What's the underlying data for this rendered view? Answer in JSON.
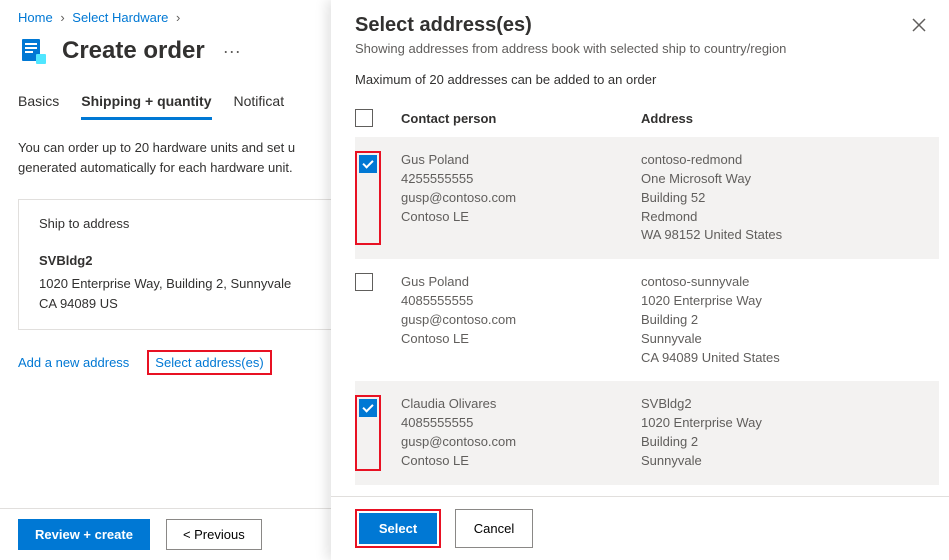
{
  "breadcrumb": {
    "home": "Home",
    "select_hw": "Select Hardware"
  },
  "page": {
    "title": "Create order",
    "tabs": {
      "basics": "Basics",
      "shipping": "Shipping + quantity",
      "notif": "Notificat"
    },
    "desc_line1": "You can order up to 20 hardware units and set u",
    "desc_line2": "generated automatically for each hardware unit."
  },
  "ship": {
    "label": "Ship to address",
    "name": "SVBldg2",
    "line1": "1020 Enterprise Way, Building 2, Sunnyvale",
    "line2": "CA 94089 US"
  },
  "actions": {
    "add_new": "Add a new address",
    "select_addr": "Select address(es)"
  },
  "footer": {
    "review": "Review + create",
    "prev": "< Previous"
  },
  "panel": {
    "title": "Select address(es)",
    "sub": "Showing addresses from address book with selected ship to country/region",
    "note": "Maximum of 20 addresses can be added to an order",
    "col_contact": "Contact person",
    "col_address": "Address",
    "select_btn": "Select",
    "cancel_btn": "Cancel",
    "rows": [
      {
        "checked": true,
        "contact": [
          "Gus Poland",
          "4255555555",
          "gusp@contoso.com",
          "Contoso LE"
        ],
        "address": [
          "contoso-redmond",
          "One Microsoft Way",
          "Building 52",
          "Redmond",
          "WA 98152 United States"
        ]
      },
      {
        "checked": false,
        "contact": [
          "Gus Poland",
          "4085555555",
          "gusp@contoso.com",
          "Contoso LE"
        ],
        "address": [
          "contoso-sunnyvale",
          "1020 Enterprise Way",
          "Building 2",
          "Sunnyvale",
          "CA 94089 United States"
        ]
      },
      {
        "checked": true,
        "contact": [
          "Claudia Olivares",
          "4085555555",
          "gusp@contoso.com",
          "Contoso LE"
        ],
        "address": [
          "SVBldg2",
          "1020 Enterprise Way",
          "Building 2",
          "Sunnyvale"
        ]
      }
    ]
  }
}
